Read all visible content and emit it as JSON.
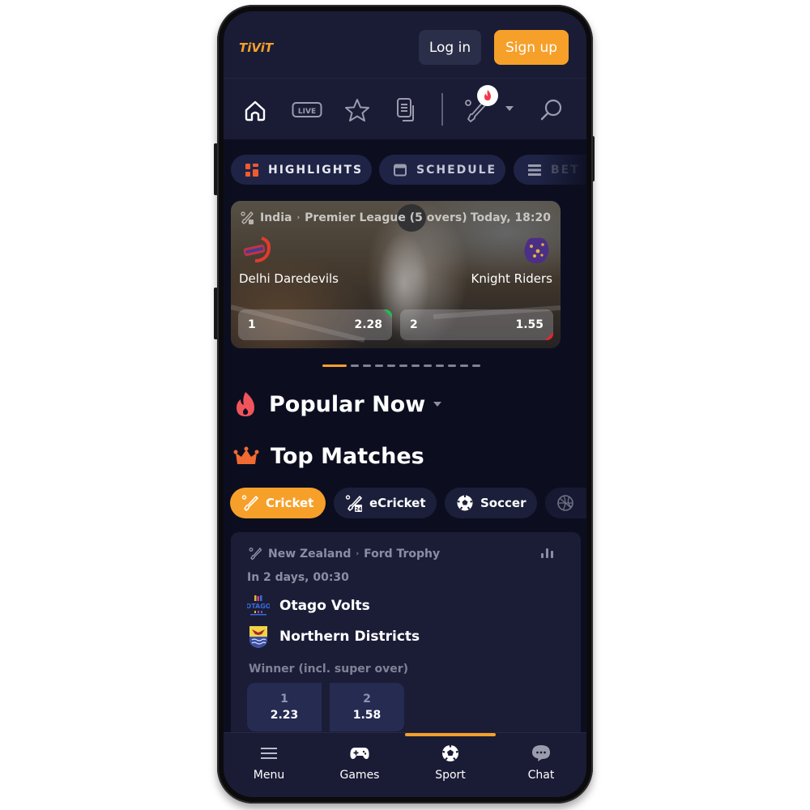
{
  "header": {
    "logo": "TiViT",
    "login_label": "Log in",
    "signup_label": "Sign up"
  },
  "nav": {
    "icons": [
      "home-icon",
      "live-icon",
      "star-icon",
      "betslip-icon",
      "cricket-icon",
      "search-icon"
    ],
    "live_label": "LIVE"
  },
  "tabs": [
    {
      "label": "HIGHLIGHTS",
      "icon": "grid-icon",
      "active": true
    },
    {
      "label": "SCHEDULE",
      "icon": "calendar-icon",
      "active": false
    },
    {
      "label": "BET",
      "icon": "list-icon",
      "active": false
    }
  ],
  "banner": {
    "country": "India",
    "league": "Premier League (5 overs)",
    "time": "Today, 18:20",
    "team1": "Delhi Daredevils",
    "team2": "Knight Riders",
    "odds": [
      {
        "label": "1",
        "value": "2.28",
        "trend": "up"
      },
      {
        "label": "2",
        "value": "1.55",
        "trend": "down"
      }
    ],
    "slides_total": 12,
    "slide_active": 1
  },
  "sections": {
    "popular": "Popular Now",
    "top": "Top Matches"
  },
  "sports": [
    {
      "label": "Cricket",
      "icon": "cricket-icon",
      "active": true
    },
    {
      "label": "eCricket",
      "icon": "ecricket-icon",
      "active": false
    },
    {
      "label": "Soccer",
      "icon": "soccer-icon",
      "active": false
    },
    {
      "label": "",
      "icon": "basketball-icon",
      "active": false
    }
  ],
  "match": {
    "country": "New Zealand",
    "league": "Ford Trophy",
    "time": "In 2 days, 00:30",
    "team1": "Otago Volts",
    "team2": "Northern Districts",
    "market": "Winner (incl. super over)",
    "odds": [
      {
        "label": "1",
        "value": "2.23"
      },
      {
        "label": "2",
        "value": "1.58"
      }
    ]
  },
  "bottom_nav": [
    {
      "label": "Menu",
      "icon": "menu-icon"
    },
    {
      "label": "Games",
      "icon": "gamepad-icon"
    },
    {
      "label": "Sport",
      "icon": "soccer-ball-icon",
      "active": true
    },
    {
      "label": "Chat",
      "icon": "chat-icon"
    }
  ],
  "colors": {
    "accent": "#f6a02a",
    "background": "#0c0e20",
    "header": "#1a1c36",
    "card": "#1b1d37",
    "odd_up": "#1fbf4e",
    "odd_down": "#e0262c"
  }
}
